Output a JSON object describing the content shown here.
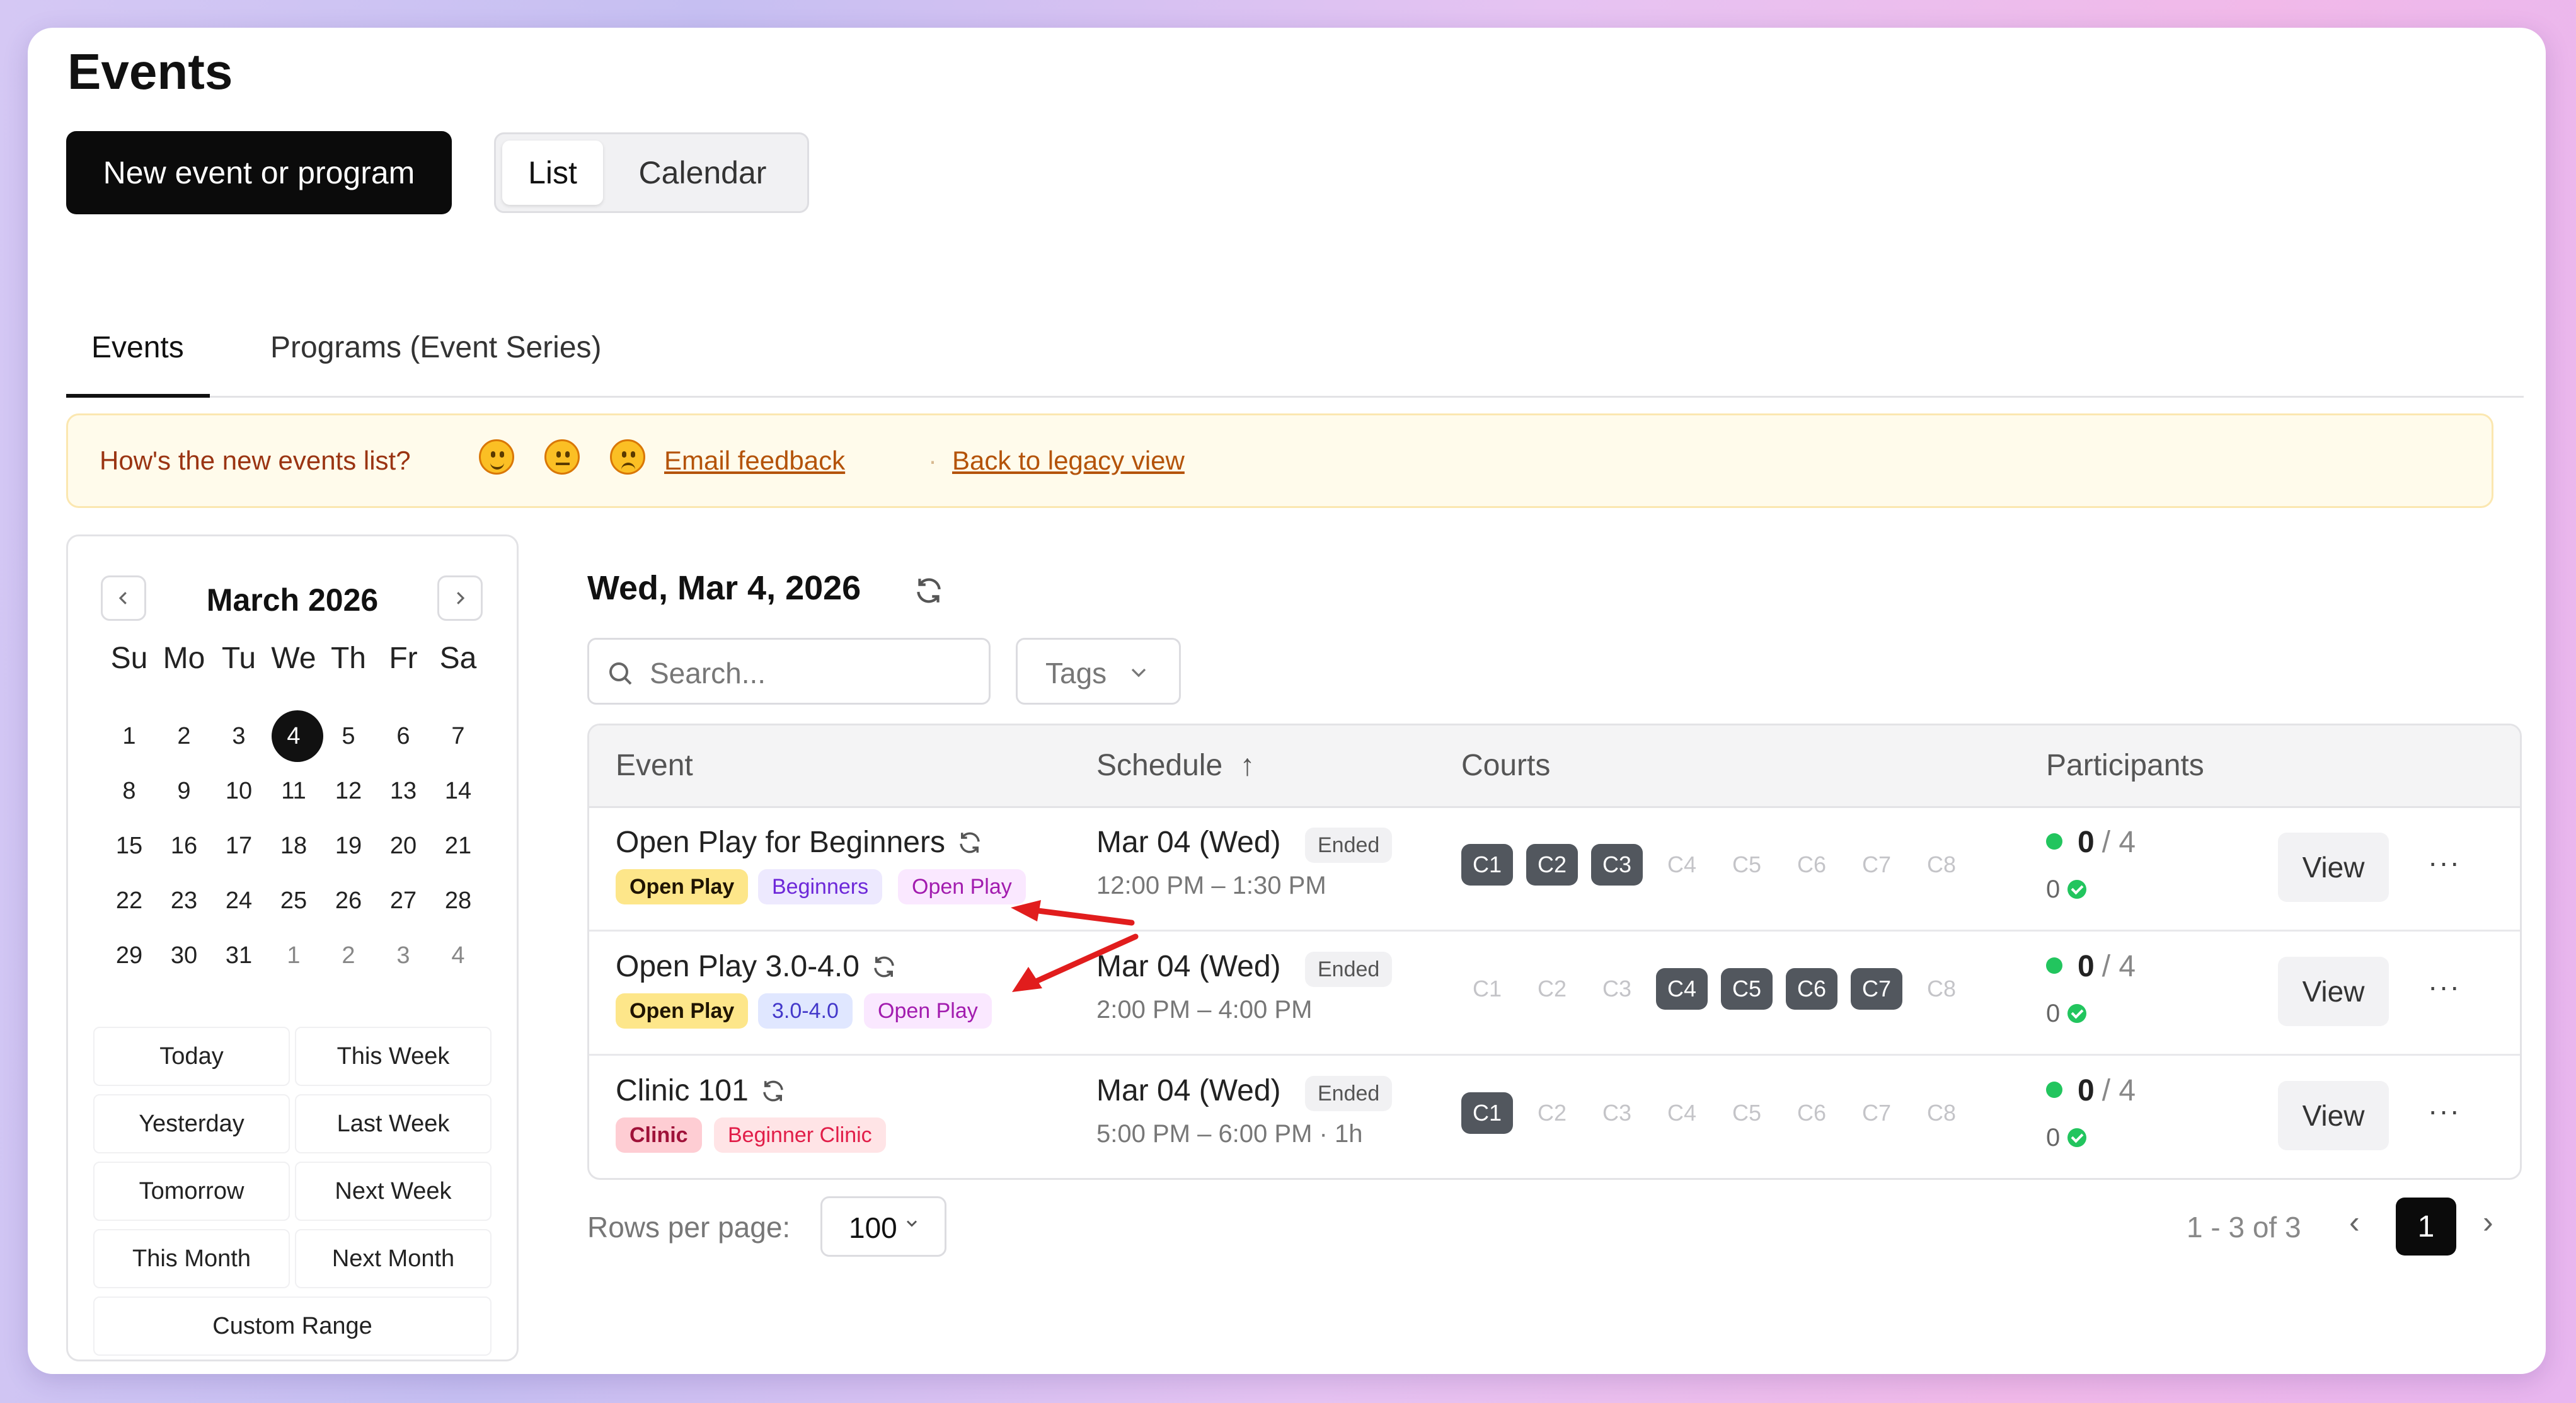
{
  "page": {
    "title": "Events"
  },
  "actions": {
    "new_event": "New event or program"
  },
  "view_toggle": {
    "list": "List",
    "calendar": "Calendar"
  },
  "tabs": {
    "events": "Events",
    "programs": "Programs (Event Series)"
  },
  "feedback": {
    "question": "How's the new events list?",
    "reactions": [
      "happy-face-icon",
      "neutral-face-icon",
      "sad-face-icon"
    ],
    "email_link": "Email feedback",
    "separator": "·",
    "legacy_link": "Back to legacy view"
  },
  "calendar": {
    "month_label": "March 2026",
    "weekdays": [
      "Su",
      "Mo",
      "Tu",
      "We",
      "Th",
      "Fr",
      "Sa"
    ],
    "weeks": [
      [
        "1",
        "2",
        "3",
        "4",
        "5",
        "6",
        "7"
      ],
      [
        "8",
        "9",
        "10",
        "11",
        "12",
        "13",
        "14"
      ],
      [
        "15",
        "16",
        "17",
        "18",
        "19",
        "20",
        "21"
      ],
      [
        "22",
        "23",
        "24",
        "25",
        "26",
        "27",
        "28"
      ],
      [
        "29",
        "30",
        "31",
        "1",
        "2",
        "3",
        "4"
      ]
    ],
    "selected_day": "4",
    "presets": {
      "today": "Today",
      "this_week": "This Week",
      "yesterday": "Yesterday",
      "last_week": "Last Week",
      "tomorrow": "Tomorrow",
      "next_week": "Next Week",
      "this_month": "This Month",
      "next_month": "Next Month",
      "custom_range": "Custom Range"
    }
  },
  "list": {
    "date_heading": "Wed, Mar 4, 2026",
    "search_placeholder": "Search...",
    "tags_label": "Tags",
    "columns": {
      "event": "Event",
      "schedule": "Schedule",
      "courts": "Courts",
      "participants": "Participants"
    },
    "sort_indicator": "↑",
    "courts_all": [
      "C1",
      "C2",
      "C3",
      "C4",
      "C5",
      "C6",
      "C7",
      "C8"
    ],
    "rows": [
      {
        "name": "Open Play for Beginners",
        "tags": [
          "Open Play",
          "Beginners",
          "Open Play"
        ],
        "date": "Mar 04 (Wed)",
        "status": "Ended",
        "time": "12:00 PM – 1:30 PM",
        "courts_active": [
          "C1",
          "C2",
          "C3"
        ],
        "registered": "0",
        "capacity": "/ 4",
        "checked_in": "0",
        "view": "View",
        "more": "···"
      },
      {
        "name": "Open Play 3.0-4.0",
        "tags": [
          "Open Play",
          "3.0-4.0",
          "Open Play"
        ],
        "date": "Mar 04 (Wed)",
        "status": "Ended",
        "time": "2:00 PM – 4:00 PM",
        "courts_active": [
          "C4",
          "C5",
          "C6",
          "C7"
        ],
        "registered": "0",
        "capacity": "/ 4",
        "checked_in": "0",
        "view": "View",
        "more": "···"
      },
      {
        "name": "Clinic 101",
        "tags": [
          "Clinic",
          "Beginner Clinic"
        ],
        "date": "Mar 04 (Wed)",
        "status": "Ended",
        "time": "5:00 PM – 6:00 PM · 1h",
        "courts_active": [
          "C1"
        ],
        "registered": "0",
        "capacity": "/ 4",
        "checked_in": "0",
        "view": "View",
        "more": "···"
      }
    ]
  },
  "pagination": {
    "rows_per_page_label": "Rows per page:",
    "rows_per_page": "100",
    "range": "1 - 3 of 3",
    "current_page": "1",
    "prev": "‹",
    "next": "›"
  },
  "colors": {
    "accent": "#0b0b0b",
    "court_active": "#52575e",
    "success": "#22c55e",
    "annotation_arrow": "#e11d1d"
  }
}
